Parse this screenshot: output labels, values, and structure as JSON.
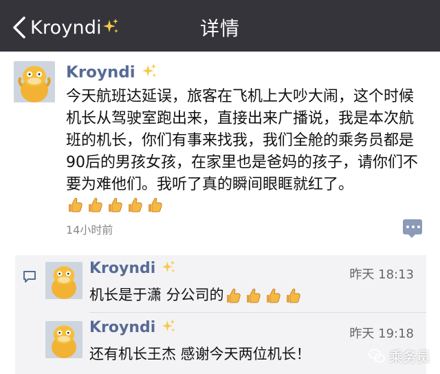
{
  "nav": {
    "back_label": "Kroyndi",
    "title": "详情"
  },
  "post": {
    "author": "Kroyndi",
    "text": "今天航班达延误，旅客在飞机上大吵大闹，这个时候机长从驾驶室跑出来，直接出来广播说，我是本次航班的机长，你们有事来找我，我们全舱的乘务员都是90后的男孩女孩，在家里也是爸妈的孩子，请你们不要为难他们。我听了真的瞬间眼眶就红了。",
    "thumbs_count": 5,
    "time": "14小时前"
  },
  "comments": [
    {
      "author": "Kroyndi",
      "time": "昨天 18:13",
      "text": "机长是于潇 分公司的",
      "thumbs_count": 4
    },
    {
      "author": "Kroyndi",
      "time": "昨天 19:18",
      "text": "还有机长王杰 感谢今天两位机长！",
      "thumbs_count": 0
    }
  ],
  "watermark": {
    "text": "乘务员"
  },
  "colors": {
    "nav_bg": "#34343a",
    "name_link": "#576b95",
    "comment_bg": "#f3f3f5"
  },
  "icons": {
    "back": "chevron-left-icon",
    "sparkle": "sparkles-icon",
    "thumb": "thumbs-up-icon",
    "comment": "comment-bubble-icon",
    "more": "more-dots-icon",
    "watermark": "wechat-logo-icon"
  }
}
